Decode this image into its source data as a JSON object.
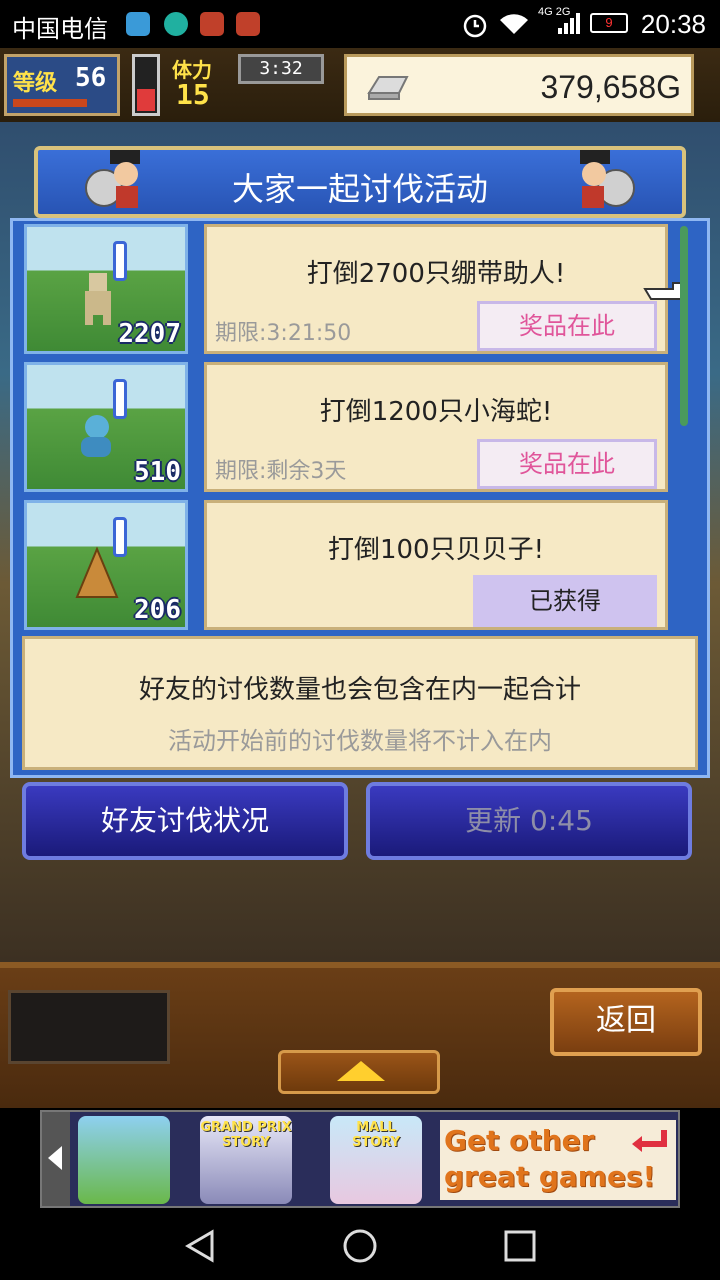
{
  "status_bar": {
    "carrier": "中国电信",
    "network": "4G 2G",
    "battery": "9",
    "time": "20:38"
  },
  "hud": {
    "level_label": "等级",
    "level": "56",
    "level_progress": 0.75,
    "stamina_label": "体力",
    "stamina": "15",
    "stamina_level": 0.4,
    "timer": "3:32",
    "gold": "379,658G"
  },
  "dialog": {
    "title": "大家一起讨伐活动",
    "events": [
      {
        "goal": "打倒2700只绷带助人!",
        "deadline": "期限:3:21:50",
        "count": "2207",
        "action": "奖品在此",
        "state": "prize"
      },
      {
        "goal": "打倒1200只小海蛇!",
        "deadline": "期限:剩余3天",
        "count": "510",
        "action": "奖品在此",
        "state": "prize"
      },
      {
        "goal": "打倒100只贝贝子!",
        "deadline": "",
        "count": "206",
        "action": "已获得",
        "state": "claimed"
      }
    ],
    "info_main": "好友的讨伐数量也会包含在内一起合计",
    "info_sub": "活动开始前的讨伐数量将不计入在内",
    "friend_button": "好友讨伐状况",
    "refresh_button": "更新 0:45"
  },
  "bottom": {
    "back_button": "返回"
  },
  "ad": {
    "games": [
      "",
      "GRAND PRIX STORY",
      "MALL STORY"
    ],
    "cta_line1": "Get other",
    "cta_line2": "great games!"
  },
  "colors": {
    "panel_blue": "#2e64c4",
    "card_bg": "#f6e9c5",
    "prize_text": "#e0559a",
    "claimed_bg": "#cfc3ef"
  }
}
